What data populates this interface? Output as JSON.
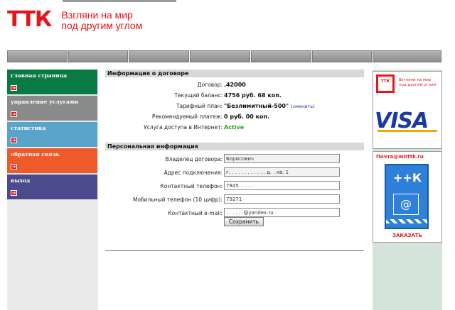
{
  "header": {
    "logo_mark": "ТТК",
    "tagline_line1": "Взгляни на мир",
    "tagline_line2": "под другим углом"
  },
  "sidebar": {
    "items": [
      {
        "label": "главная страница",
        "color": "#0a7a45"
      },
      {
        "label": "управление услугами",
        "color": "#8a8a8a"
      },
      {
        "label": "статистика",
        "color": "#5ba4c9"
      },
      {
        "label": "обратная связь",
        "color": "#ef5a2a"
      },
      {
        "label": "выход",
        "color": "#4a4a8c"
      }
    ],
    "arrow_icon": "arrow-right-icon"
  },
  "contract": {
    "title": "Информация о договоре",
    "rows": [
      {
        "label": "Договор:",
        "value": ".42000"
      },
      {
        "label": "Текущий баланс:",
        "value": "4756 руб. 68 коп."
      },
      {
        "label": "Тарифный план:",
        "value": "\"Безлимитный-500\"",
        "link": "(сменить)"
      },
      {
        "label": "Рекомендуемый платеж:",
        "value": "0 руб. 00 коп."
      },
      {
        "label": "Услуга доступа в Интернет:",
        "value": "Active"
      }
    ]
  },
  "personal": {
    "title": "Персональная информация",
    "fields": [
      {
        "label": "Владелец договора:",
        "value": "Борисович"
      },
      {
        "label": "Адрес подключения:",
        "value": "г. . . . . . . . . . . . д. . кв. 1"
      },
      {
        "label": "Контактный телефон:",
        "value": "7845. . . . ."
      },
      {
        "label": "Мобильный телефон (10 цифр):",
        "value": "79271"
      },
      {
        "label": "Контактный e-mail:",
        "value": ". . . . . .@yandex.ru"
      }
    ],
    "save_label": "Сохранить"
  },
  "ads": {
    "ad1_text1": "Взгляни на мир",
    "ad1_text2": "под другим углом",
    "ad1_logo": "ТТК",
    "ad1_card": "VISA",
    "ad2_email": "Почта@mirttk.ru",
    "ad2_logo": "++К",
    "ad2_at": "@",
    "ad2_order": "ЗАКАЗАТЬ"
  },
  "colors": {
    "brand_red": "#e8141c",
    "active_green": "#26a61f",
    "link_blue": "#1a37a8"
  }
}
